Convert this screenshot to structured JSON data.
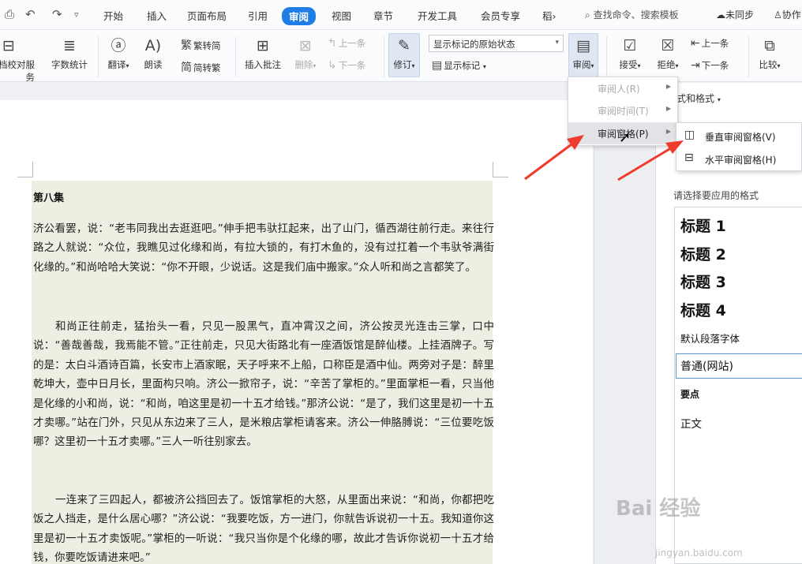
{
  "menubar": {
    "tabs": [
      "开始",
      "插入",
      "页面布局",
      "引用",
      "审阅",
      "视图",
      "章节",
      "开发工具",
      "会员专享",
      "稻›"
    ],
    "active_tab": "审阅",
    "search": "查找命令、搜索模板",
    "unsync": "未同步",
    "collab": "协作"
  },
  "ribbon": {
    "doc_service": "文档校对服务",
    "word_count": "字数统计",
    "translate": "翻译",
    "read_aloud": "朗读",
    "trad_simp": "繁转简",
    "simp_trad": "简转繁",
    "insert_comment": "插入批注",
    "delete": "删除",
    "prev_comment": "上一条",
    "next_comment": "下一条",
    "track_changes": "修订",
    "display_state": "显示标记的原始状态",
    "show_markup": "显示标记",
    "review": "审阅",
    "accept": "接受",
    "reject": "拒绝",
    "prev": "上一条",
    "next": "下一条",
    "compare": "比较"
  },
  "review_menu": {
    "reviewer": "审阅人(R)",
    "review_time": "审阅时间(T)",
    "review_pane": "审阅窗格(P)"
  },
  "pane_menu": {
    "vertical": "垂直审阅窗格(V)",
    "horizontal": "水平审阅窗格(H)"
  },
  "pane": {
    "header": "样式和格式",
    "prompt": "请选择要应用的格式",
    "styles": [
      "标题 1",
      "标题 2",
      "标题 3",
      "标题 4",
      "默认段落字体",
      "普通(网站)",
      "要点",
      "正文"
    ]
  },
  "document": {
    "heading": "第八集",
    "paragraphs": [
      "济公看罢，说：“老韦同我出去逛逛吧。”伸手把韦驮扛起来，出了山门，循西湖往前行走。来往行路之人就说：“众位，我瞧见过化缘和尚，有拉大锁的，有打木鱼的，没有过扛着一个韦驮爷满街化缘的。”和尚哈哈大笑说：“你不开眼，少说话。这是我们庙中搬家。”众人听和尚之言都笑了。",
      "和尚正往前走，猛抬头一看，只见一股黑气，直冲霄汉之间，济公按灵光连击三掌，口中说：“善哉善哉，我焉能不管。”正往前走，只见大街路北有一座酒饭馆是醉仙楼。上挂酒牌子。写的是：太白斗酒诗百篇，长安市上酒家眠，天子呼来不上船，口称臣是酒中仙。两旁对子是：醉里乾坤大，壶中日月长，里面构只响。济公一掀帘子，说：“辛苦了掌柜的。”里面掌柜一看，只当他是化缘的小和尚，说：“和尚，咱这里是初一十五才给钱。”那济公说：“是了，我们这里是初一十五才卖哪。”站在门外，只见从东边来了三人，是米粮店掌柜请客来。济公一伸胳膊说：“三位要吃饭哪？这里初一十五才卖哪。”三人一听往别家去。",
      "一连来了三四起人，都被济公挡回去了。饭馆掌柜的大怒，从里面出来说：“和尚，你都把吃饭之人挡走，是什么居心哪？”济公说：“我要吃饭，方一进门，你就告诉说初一十五。我知道你这里是初一十五才卖饭呢。”掌柜的一听说：“我只当你是个化缘的哪，故此才告诉你说初一十五才给钱，你要吃饭请进来吧。”"
    ]
  },
  "watermark": {
    "brand": "Bai 经验",
    "url": "jingyan.baidu.com"
  }
}
